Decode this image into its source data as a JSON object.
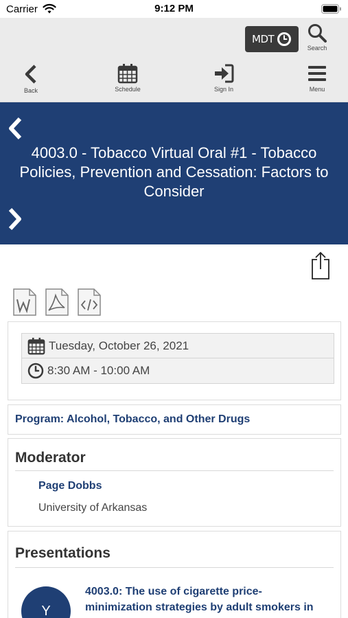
{
  "status_bar": {
    "carrier": "Carrier",
    "time": "9:12 PM"
  },
  "header": {
    "mdt_label": "MDT",
    "search_label": "Search",
    "nav": {
      "back_label": "Back",
      "schedule_label": "Schedule",
      "signin_label": "Sign In",
      "menu_label": "Menu"
    }
  },
  "session": {
    "title": "4003.0 - Tobacco Virtual Oral #1 - Tobacco Policies, Prevention and Cessation: Factors to Consider",
    "date": "Tuesday, October 26, 2021",
    "time": "8:30 AM - 10:00 AM",
    "program": "Program: Alcohol, Tobacco, and Other Drugs"
  },
  "moderator": {
    "heading": "Moderator",
    "name": "Page Dobbs",
    "org": "University of Arkansas"
  },
  "presentations": {
    "heading": "Presentations",
    "items": [
      {
        "avatar": "Y",
        "title": "4003.0: The use of cigarette price-minimization strategies by adult smokers in"
      }
    ]
  },
  "colors": {
    "brand": "#1f3f74",
    "header_bg": "#ebebeb",
    "mdt_bg": "#3a3a3a"
  },
  "icons": [
    "wifi-icon",
    "battery-icon",
    "clock-icon",
    "search-icon",
    "back-chevron-icon",
    "calendar-icon",
    "sign-in-icon",
    "hamburger-menu-icon",
    "chevron-left-icon",
    "chevron-right-icon",
    "share-icon",
    "word-doc-icon",
    "pdf-doc-icon",
    "code-doc-icon"
  ]
}
